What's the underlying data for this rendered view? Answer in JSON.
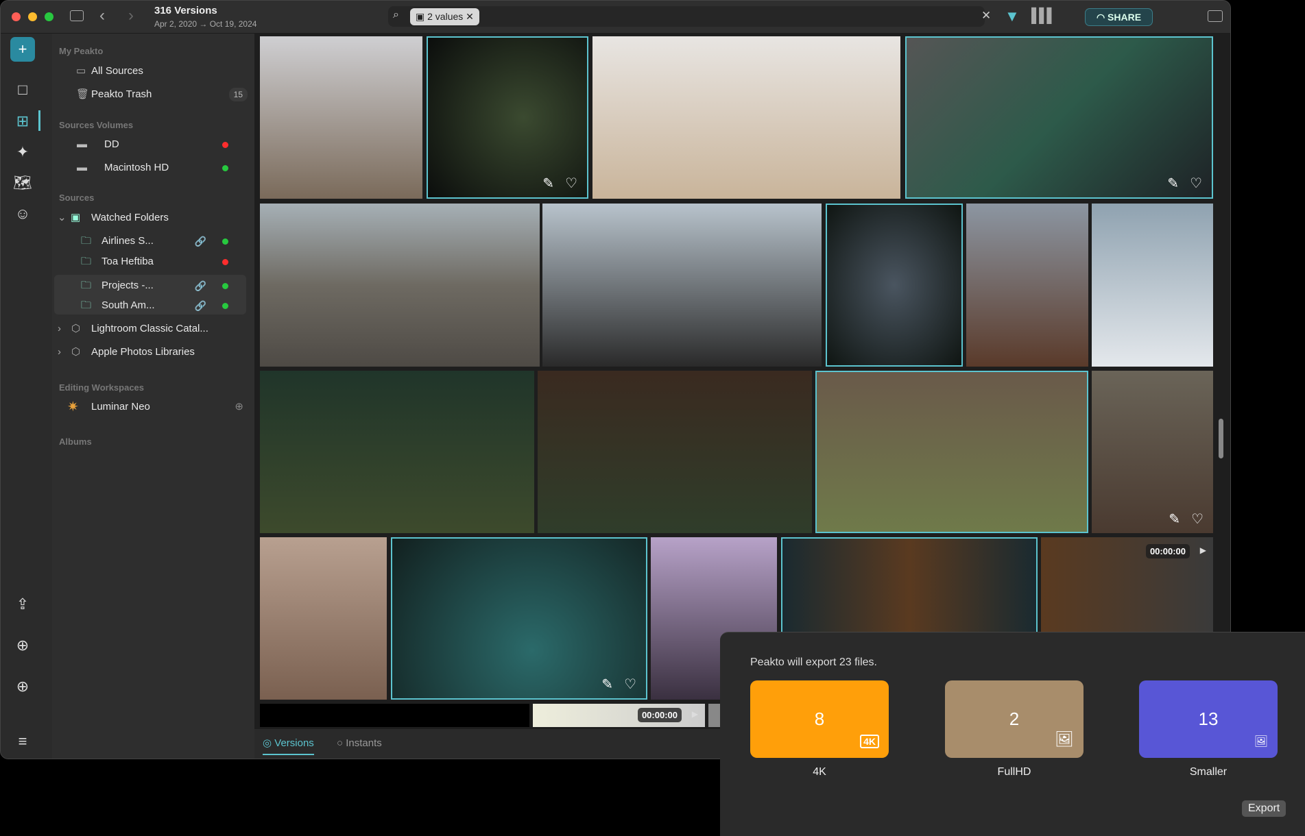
{
  "window": {
    "title": "316 Versions",
    "subtitle": "Apr 2, 2020 → Oct 19, 2024"
  },
  "search": {
    "chip_label": "2 values",
    "share_label": "SHARE"
  },
  "sidebar": {
    "sections": {
      "my_peakto": "My Peakto",
      "volumes": "Sources Volumes",
      "sources": "Sources",
      "workspaces": "Editing Workspaces",
      "albums": "Albums"
    },
    "my_peakto": [
      {
        "label": "All Sources",
        "icon": "archive-icon"
      },
      {
        "label": "Peakto Trash",
        "icon": "trash-icon",
        "badge": "15"
      }
    ],
    "volumes": [
      {
        "label": "DD",
        "status": "#ff2d2d"
      },
      {
        "label": "Macintosh HD",
        "status": "#27c93f"
      }
    ],
    "watched": {
      "label": "Watched Folders",
      "folders": [
        {
          "label": "Airlines S...",
          "linked": true,
          "status": "#27c93f"
        },
        {
          "label": "Toa Heftiba",
          "linked": false,
          "status": "#ff2d2d"
        },
        {
          "label": "Projects -...",
          "linked": true,
          "status": "#27c93f"
        },
        {
          "label": "South Am...",
          "linked": true,
          "status": "#27c93f"
        }
      ]
    },
    "catalogs": [
      {
        "label": "Lightroom Classic Catal..."
      },
      {
        "label": "Apple Photos Libraries"
      }
    ],
    "workspaces": [
      {
        "label": "Luminar Neo"
      }
    ]
  },
  "grid": {
    "durations": [
      "00:00:00",
      "00:00:00"
    ],
    "accent": "#5cc4cf"
  },
  "bottom_tabs": [
    {
      "label": "Versions",
      "active": true
    },
    {
      "label": "Instants",
      "active": false
    }
  ],
  "export": {
    "message": "Peakto will export 23 files.",
    "cards": [
      {
        "count": "8",
        "label": "4K",
        "color": "#ff9f0a",
        "icon": "4k-display-icon"
      },
      {
        "count": "2",
        "label": "FullHD",
        "color": "#a88d6b",
        "icon": "image-icon"
      },
      {
        "count": "13",
        "label": "Smaller",
        "color": "#5856d6",
        "icon": "small-image-icon"
      }
    ],
    "button": "Export"
  }
}
